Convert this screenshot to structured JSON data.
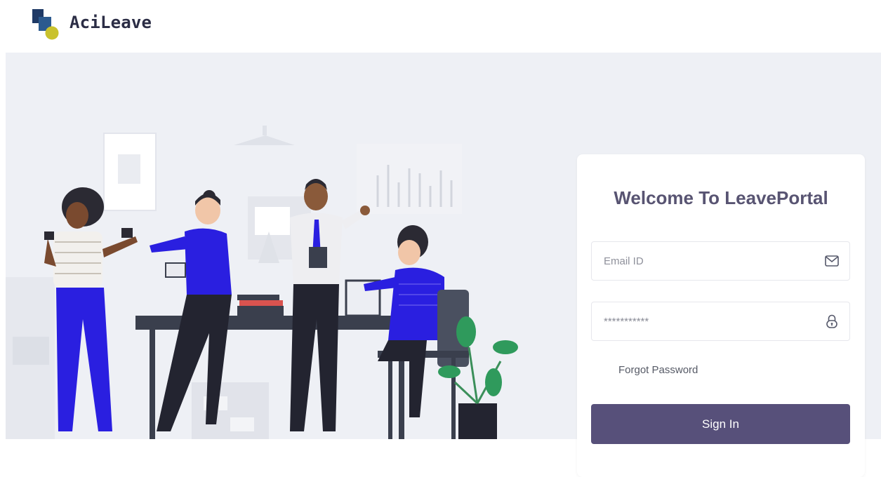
{
  "header": {
    "brand_name": "AciLeave",
    "logo_icon": "acileave-logo-icon"
  },
  "login": {
    "title": "Welcome To LeavePortal",
    "email": {
      "placeholder": "Email ID",
      "icon": "envelope-icon"
    },
    "password": {
      "value": "***********",
      "icon": "lock-icon"
    },
    "forgot_label": "Forgot Password",
    "signin_label": "Sign In"
  },
  "illustration": {
    "subject": "team-collaboration-office-illustration"
  },
  "colors": {
    "brand_dark": "#2b2d45",
    "primary": "#57507a",
    "title": "#585472",
    "page_bg": "#eef0f5",
    "accent_blue": "#2a1fe0",
    "logo_navy": "#1f3a66",
    "logo_olive": "#c9c22d"
  }
}
